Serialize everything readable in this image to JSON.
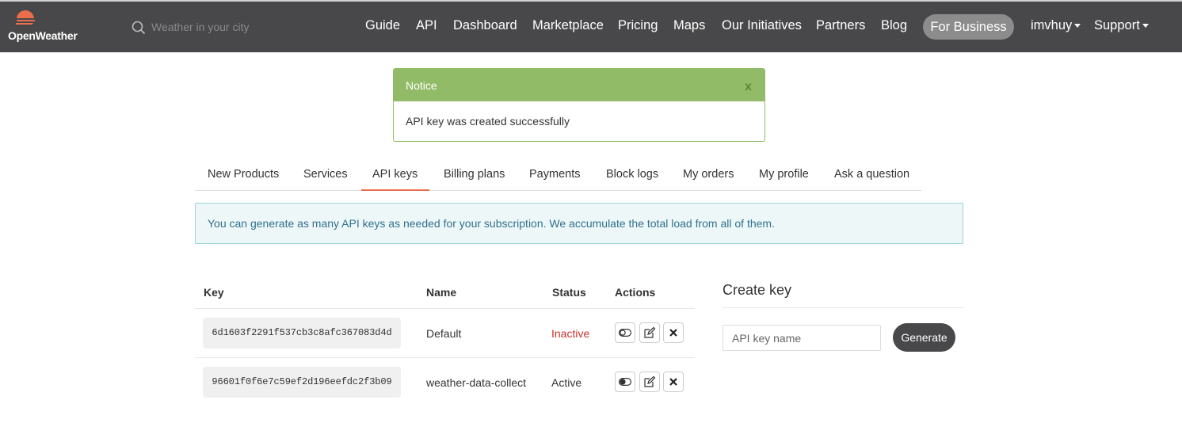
{
  "brand": {
    "logo_text": "OpenWeather",
    "logo_color": "#eb6e4b"
  },
  "search": {
    "placeholder": "Weather in your city",
    "icon": "search-icon"
  },
  "nav": {
    "items": [
      "Guide",
      "API",
      "Dashboard",
      "Marketplace",
      "Pricing",
      "Maps",
      "Our Initiatives",
      "Partners",
      "Blog"
    ],
    "business": "For Business",
    "user": "imvhuy",
    "support": "Support"
  },
  "notice": {
    "title": "Notice",
    "close": "x",
    "message": "API key was created successfully"
  },
  "tabs": {
    "items": [
      "New Products",
      "Services",
      "API keys",
      "Billing plans",
      "Payments",
      "Block logs",
      "My orders",
      "My profile",
      "Ask a question"
    ],
    "active": "API keys"
  },
  "info": {
    "text": "You can generate as many API keys as needed for your subscription. We accumulate the total load from all of them."
  },
  "table": {
    "headers": {
      "key": "Key",
      "name": "Name",
      "status": "Status",
      "actions": "Actions"
    },
    "rows": [
      {
        "key": "6d1603f2291f537cb3c8afc367083d4d",
        "name": "Default",
        "status": "Inactive"
      },
      {
        "key": "96601f0f6e7c59ef2d196eefdc2f3b09",
        "name": "weather-data-collect",
        "status": "Active"
      }
    ]
  },
  "create_key": {
    "title": "Create key",
    "placeholder": "API key name",
    "button": "Generate"
  },
  "colors": {
    "navbar": "#48484a",
    "notice_green": "#92bb68",
    "accent": "#e96e50",
    "inactive": "#c9302c"
  }
}
